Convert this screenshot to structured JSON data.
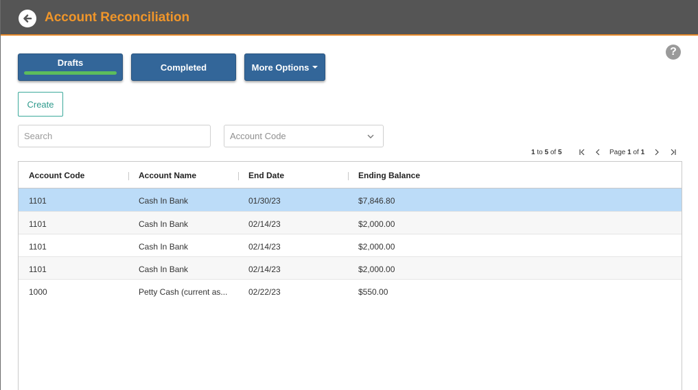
{
  "header": {
    "title": "Account Reconciliation"
  },
  "tabs": {
    "drafts": "Drafts",
    "completed": "Completed",
    "more_options": "More Options"
  },
  "create_label": "Create",
  "search": {
    "placeholder": "Search"
  },
  "account_code_select": {
    "placeholder": "Account Code"
  },
  "pagination": {
    "range_start": "1",
    "range_to": "to",
    "range_end": "5",
    "range_of": "of",
    "total": "5",
    "page_label": "Page",
    "current_page": "1",
    "page_of": "of",
    "total_pages": "1"
  },
  "table": {
    "columns": [
      "Account Code",
      "Account Name",
      "End Date",
      "Ending Balance"
    ],
    "rows": [
      {
        "code": "1101",
        "name": "Cash In Bank",
        "end_date": "01/30/23",
        "balance": "$7,846.80",
        "selected": true
      },
      {
        "code": "1101",
        "name": "Cash In Bank",
        "end_date": "02/14/23",
        "balance": "$2,000.00",
        "selected": false
      },
      {
        "code": "1101",
        "name": "Cash In Bank",
        "end_date": "02/14/23",
        "balance": "$2,000.00",
        "selected": false
      },
      {
        "code": "1101",
        "name": "Cash In Bank",
        "end_date": "02/14/23",
        "balance": "$2,000.00",
        "selected": false
      },
      {
        "code": "1000",
        "name": "Petty Cash (current as...",
        "end_date": "02/22/23",
        "balance": "$550.00",
        "selected": false
      }
    ]
  },
  "colors": {
    "header_bg": "#555555",
    "title": "#f0962a",
    "tab_bg": "#336699",
    "drafts_indicator": "#5cbd5c",
    "create_border": "#3aa89a",
    "selected_row": "#bcdcf8",
    "alt_row": "#f7f7f7"
  },
  "icons": {
    "back": "back-arrow-circle-icon",
    "help": "help-circle-icon",
    "dropdown": "chevron-down-icon",
    "first": "first-page-icon",
    "prev": "previous-page-icon",
    "next": "next-page-icon",
    "last": "last-page-icon"
  }
}
